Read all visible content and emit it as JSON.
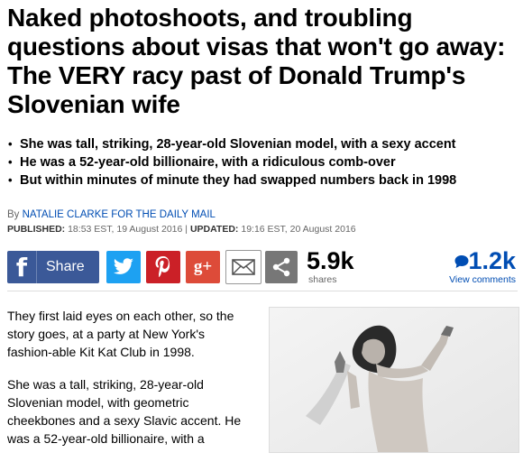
{
  "article": {
    "headline": "Naked photoshoots, and troubling questions about visas that won't go away: The VERY racy past of Donald Trump's Slovenian wife",
    "bullets": [
      "She was tall, striking, 28-year-old Slovenian model, with a sexy accent",
      "He was a 52-year-old billionaire, with a ridiculous comb-over",
      "But within minutes of minute they had swapped numbers back in 1998"
    ],
    "byline_prefix": "By",
    "byline_author": "NATALIE CLARKE FOR THE DAILY MAIL",
    "published_label": "PUBLISHED:",
    "published_value": "18:53 EST, 19 August 2016",
    "separator": "|",
    "updated_label": "UPDATED:",
    "updated_value": "19:16 EST, 20 August 2016",
    "paragraphs": [
      "They first laid eyes on each other, so the story goes, at a party at New York's fashion-able Kit Kat Club in 1998.",
      "She was a tall, striking, 28-year-old Slovenian model, with geometric cheekbones and a sexy Slavic accent. He was a 52-year-old billionaire, with a"
    ]
  },
  "share": {
    "facebook_label": "Share",
    "googleplus_label": "g+",
    "share_count": "5.9k",
    "share_count_label": "shares",
    "comment_count": "1.2k",
    "comment_label": "View comments"
  },
  "colors": {
    "facebook": "#3b5998",
    "twitter": "#1da1f2",
    "pinterest": "#cb2027",
    "googleplus": "#dd4b39",
    "link_blue": "#004db3"
  },
  "icons": [
    "facebook-icon",
    "twitter-icon",
    "pinterest-icon",
    "google-plus-icon",
    "email-icon",
    "share-icon",
    "comment-bubble-icon"
  ]
}
